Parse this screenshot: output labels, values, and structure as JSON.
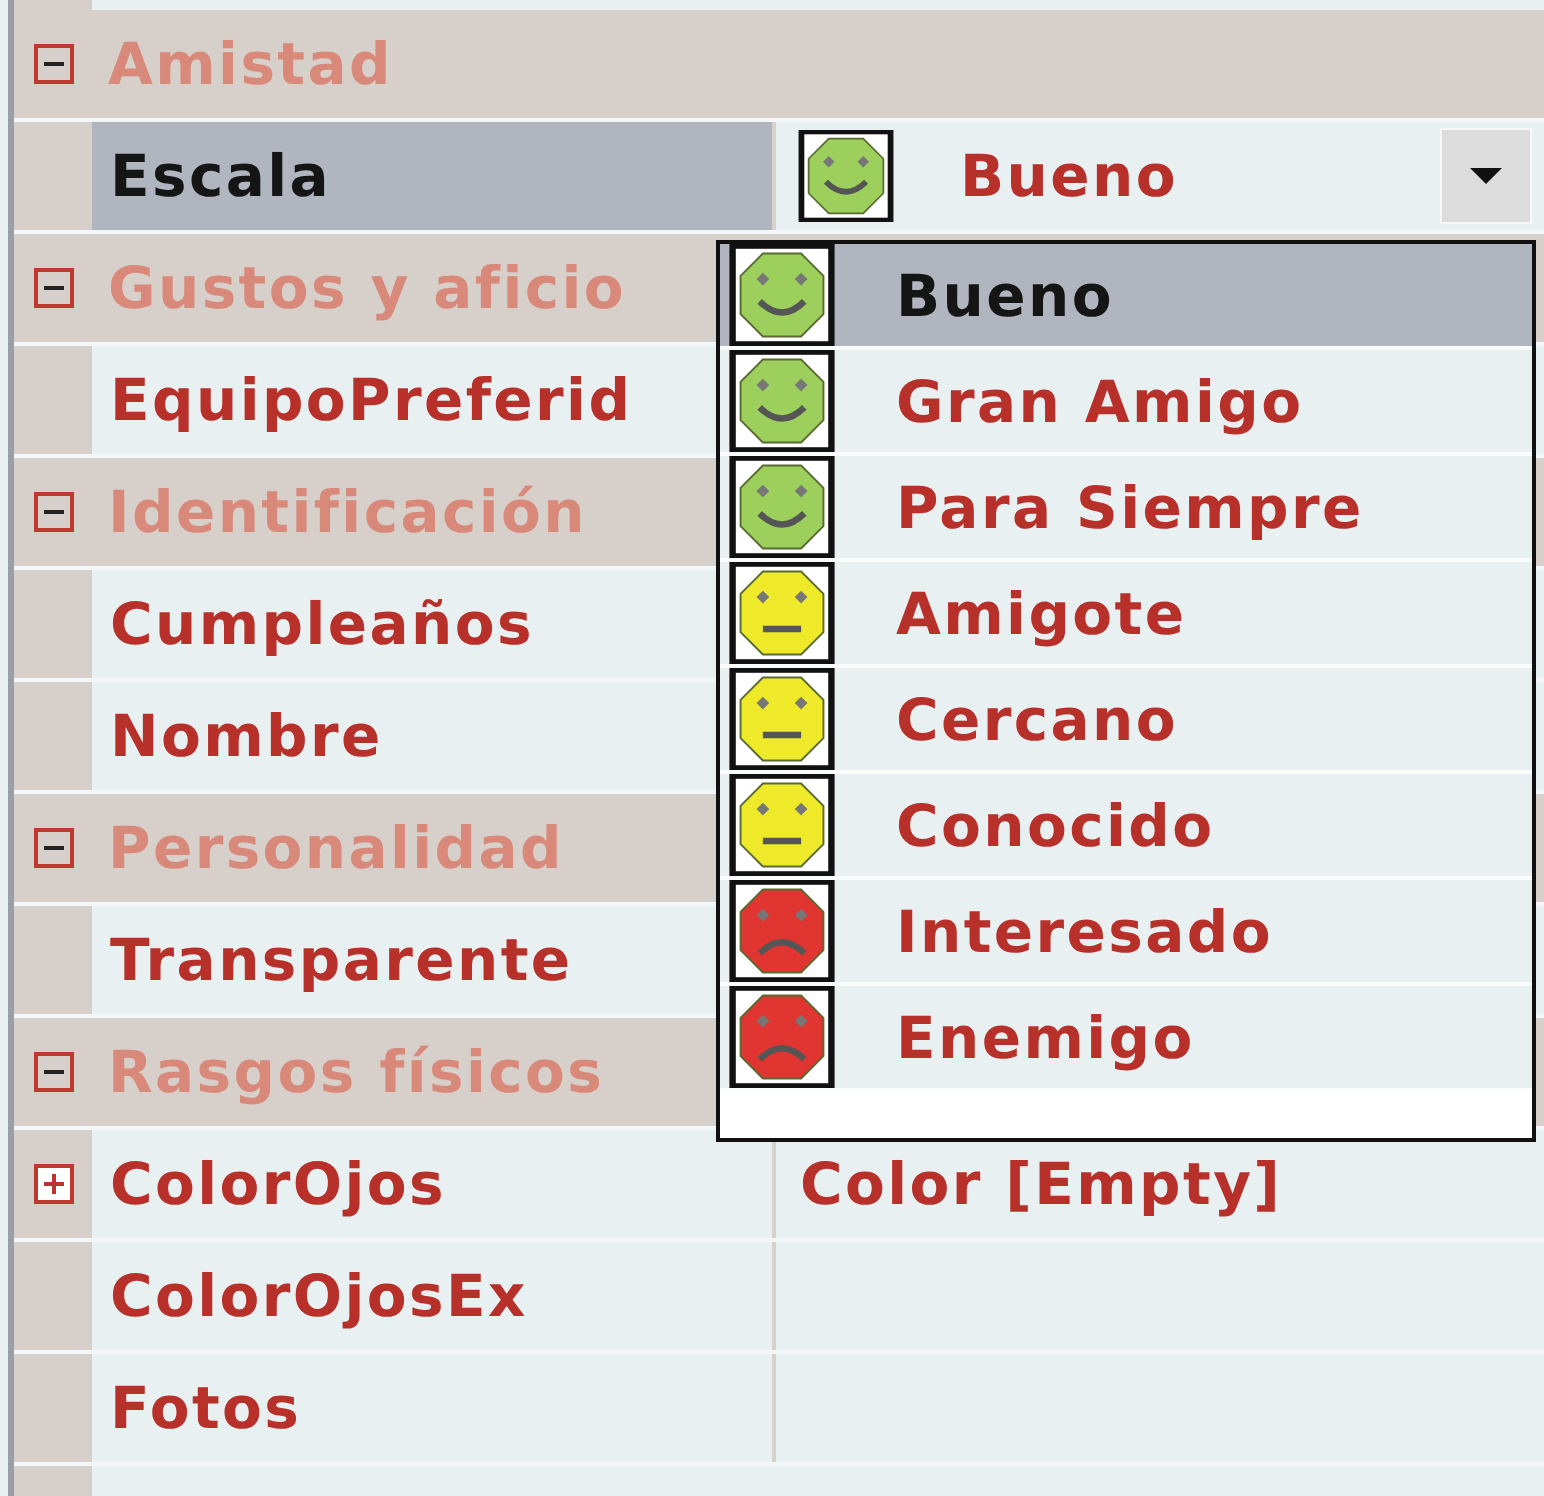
{
  "categories": [
    {
      "name": "Amistad",
      "expanded": true,
      "properties": [
        {
          "name": "Escala",
          "kind": "dropdown",
          "selected": true,
          "value": {
            "kind": "happy",
            "text": "Bueno"
          }
        }
      ]
    },
    {
      "name": "Gustos y aficio",
      "expanded": true,
      "properties": [
        {
          "name": "EquipoPreferid",
          "kind": "plain",
          "selected": false
        }
      ]
    },
    {
      "name": "Identificación",
      "expanded": true,
      "properties": [
        {
          "name": "Cumpleaños",
          "kind": "plain",
          "selected": false
        },
        {
          "name": "Nombre",
          "kind": "plain",
          "selected": false
        }
      ]
    },
    {
      "name": "Personalidad",
      "expanded": true,
      "properties": [
        {
          "name": "Transparente",
          "kind": "plain",
          "selected": false
        }
      ]
    },
    {
      "name": "Rasgos físicos",
      "expanded": true,
      "properties": [
        {
          "name": "ColorOjos",
          "kind": "group",
          "expanded": false,
          "selected": false,
          "value": {
            "text": "Color [Empty]"
          }
        },
        {
          "name": "ColorOjosEx",
          "kind": "plain",
          "selected": false
        },
        {
          "name": "Fotos",
          "kind": "plain",
          "selected": false
        }
      ]
    }
  ],
  "dropdown": {
    "items": [
      {
        "label": "Bueno",
        "kind": "happy",
        "selected": true
      },
      {
        "label": "Gran Amigo",
        "kind": "happy",
        "selected": false
      },
      {
        "label": "Para Siempre",
        "kind": "happy",
        "selected": false
      },
      {
        "label": "Amigote",
        "kind": "neutral",
        "selected": false
      },
      {
        "label": "Cercano",
        "kind": "neutral",
        "selected": false
      },
      {
        "label": "Conocido",
        "kind": "neutral",
        "selected": false
      },
      {
        "label": "Interesado",
        "kind": "sad",
        "selected": false
      },
      {
        "label": "Enemigo",
        "kind": "sad",
        "selected": false
      }
    ]
  }
}
